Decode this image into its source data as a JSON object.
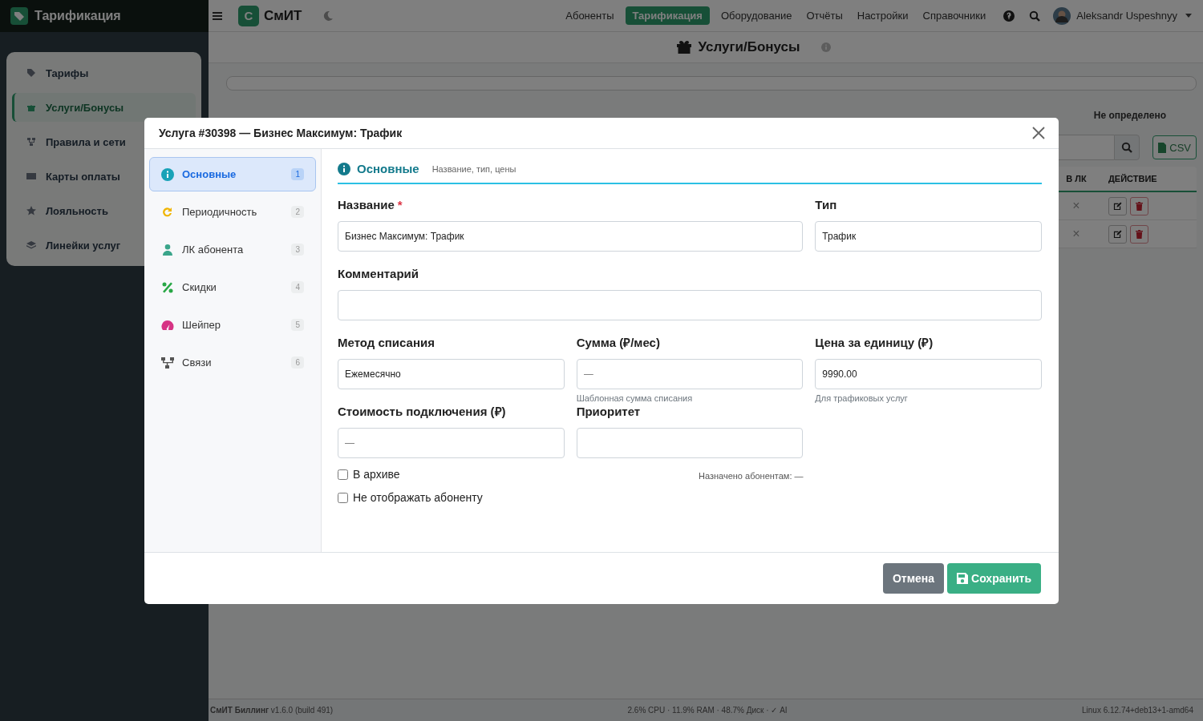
{
  "sidebar": {
    "title": "Тарификация",
    "items": [
      {
        "label": "Тарифы",
        "kind": "tag",
        "selected": false
      },
      {
        "label": "Услуги/Бонусы",
        "kind": "gift",
        "selected": true
      },
      {
        "label": "Правила и сети",
        "kind": "network",
        "selected": false
      },
      {
        "label": "Карты оплаты",
        "kind": "card",
        "selected": false
      },
      {
        "label": "Лояльность",
        "kind": "star",
        "selected": false
      },
      {
        "label": "Линейки услуг",
        "kind": "layers",
        "selected": false
      }
    ]
  },
  "topbar": {
    "brand_letter": "С",
    "brand": "СмИТ",
    "nav": [
      {
        "label": "Абоненты",
        "selected": false
      },
      {
        "label": "Тарификация",
        "selected": true
      },
      {
        "label": "Оборудование",
        "selected": false
      },
      {
        "label": "Отчёты",
        "selected": false
      },
      {
        "label": "Настройки",
        "selected": false
      },
      {
        "label": "Справочники",
        "selected": false
      }
    ],
    "user": "Aleksandr Uspeshnyy"
  },
  "page": {
    "title": "Услуги/Бонусы"
  },
  "tabs": [
    {
      "label": "Не определено",
      "selected": false
    }
  ],
  "toolbar": {
    "csv_button": "CSV"
  },
  "table": {
    "columns": [
      "В ЛК",
      "ДЕЙСТВИЕ"
    ],
    "rows": [
      {
        "in_lk": "×"
      },
      {
        "in_lk": "×"
      }
    ]
  },
  "status_bar": {
    "left": "**СмИТ Биллинг** v1.6.0 (build 491)",
    "center": "2.6% CPU · 11.9% RAM · 48.7% Диск · ✓ AI",
    "right": "Linux 6.12.74+deb13+1-amd64"
  },
  "modal": {
    "title": "Услуга #30398 — Бизнес Максимум: Трафик",
    "nav": [
      {
        "label": "Основные",
        "number": "1",
        "kind": "info",
        "selected": true
      },
      {
        "label": "Периодичность",
        "number": "2",
        "kind": "refresh",
        "selected": false
      },
      {
        "label": "ЛК абонента",
        "number": "3",
        "kind": "user",
        "selected": false
      },
      {
        "label": "Скидки",
        "number": "4",
        "kind": "percent",
        "selected": false
      },
      {
        "label": "Шейпер",
        "number": "5",
        "kind": "gauge",
        "selected": false
      },
      {
        "label": "Связи",
        "number": "6",
        "kind": "network",
        "selected": false
      }
    ],
    "section": {
      "title": "Основные",
      "subtitle": "Название, тип, цены"
    },
    "fields": [
      {
        "label": "Название",
        "required": true,
        "value": "Бизнес Максимум: Трафик"
      },
      {
        "label": "Тип",
        "required": false,
        "value": "Трафик"
      },
      {
        "label": "Комментарий",
        "required": false
      },
      {
        "label": "Метод списания",
        "required": false,
        "value": "Ежемесячно"
      },
      {
        "label": "Сумма (₽/мес)",
        "required": false,
        "placeholder": "—",
        "help": "Шаблонная сумма списания"
      },
      {
        "label": "Цена за единицу (₽)",
        "required": false,
        "value": "9990.00",
        "help": "Для трафиковых услуг"
      },
      {
        "label": "Стоимость подключения (₽)",
        "required": false,
        "placeholder": "—"
      },
      {
        "label": "Приоритет",
        "required": false
      }
    ],
    "required_mark": "*",
    "checkboxes": [
      {
        "label": "В архиве",
        "checked": false
      },
      {
        "label": "Не отображать абоненту",
        "checked": false
      }
    ],
    "assigned": "Назначено абонентам: —",
    "cancel_button": "Отмена",
    "save_button": "Сохранить"
  }
}
